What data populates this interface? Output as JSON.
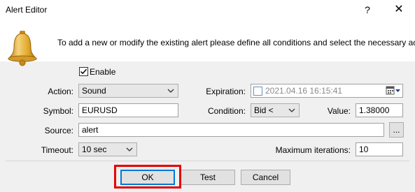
{
  "window": {
    "title": "Alert Editor",
    "help_glyph": "?",
    "close_glyph": "✕"
  },
  "header": {
    "text": "To add a new or modify the existing alert please define all conditions and select the necessary action."
  },
  "form": {
    "enable": {
      "label": "Enable",
      "checked": true
    },
    "action": {
      "label": "Action:",
      "value": "Sound"
    },
    "expiration": {
      "label": "Expiration:",
      "value": "2021.04.16 16:15:41",
      "enabled": false
    },
    "symbol": {
      "label": "Symbol:",
      "value": "EURUSD"
    },
    "condition": {
      "label": "Condition:",
      "value": "Bid <"
    },
    "value": {
      "label": "Value:",
      "value": "1.38000"
    },
    "source": {
      "label": "Source:",
      "value": "alert",
      "browse_label": "..."
    },
    "timeout": {
      "label": "Timeout:",
      "value": "10 sec"
    },
    "max_iterations": {
      "label": "Maximum iterations:",
      "value": "10"
    }
  },
  "buttons": {
    "ok": "OK",
    "test": "Test",
    "cancel": "Cancel"
  },
  "colors": {
    "highlight_border": "#e60000",
    "default_button_border": "#0078d7",
    "bell_gold": "#e2a82a"
  },
  "icons": {
    "bell": "bell-icon",
    "dropdown": "chevron-down-icon",
    "calendar": "calendar-icon",
    "check": "checkmark-icon"
  }
}
